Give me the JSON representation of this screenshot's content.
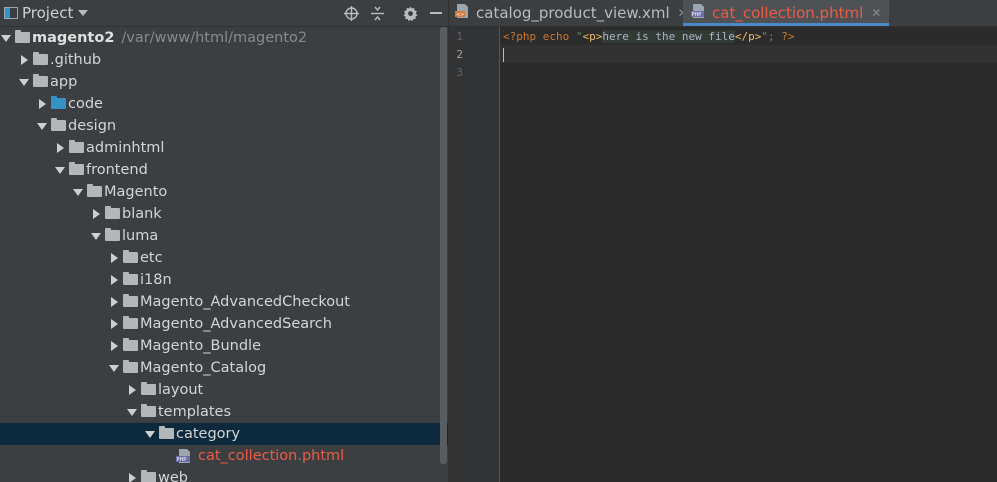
{
  "project_panel": {
    "title": "Project",
    "header_icons": [
      "locate-icon",
      "collapse-all-icon",
      "settings-gear-icon",
      "hide-panel-icon"
    ],
    "tree": [
      {
        "label": "magento2",
        "path": "/var/www/html/magento2",
        "depth": 0,
        "expanded": true,
        "icon": "folder-icon",
        "bold": true
      },
      {
        "label": ".github",
        "depth": 1,
        "expanded": false,
        "icon": "folder-icon"
      },
      {
        "label": "app",
        "depth": 1,
        "expanded": true,
        "icon": "folder-icon"
      },
      {
        "label": "code",
        "depth": 2,
        "expanded": false,
        "icon": "source-folder-icon"
      },
      {
        "label": "design",
        "depth": 2,
        "expanded": true,
        "icon": "folder-icon"
      },
      {
        "label": "adminhtml",
        "depth": 3,
        "expanded": false,
        "icon": "folder-icon"
      },
      {
        "label": "frontend",
        "depth": 3,
        "expanded": true,
        "icon": "folder-icon"
      },
      {
        "label": "Magento",
        "depth": 4,
        "expanded": true,
        "icon": "folder-icon"
      },
      {
        "label": "blank",
        "depth": 5,
        "expanded": false,
        "icon": "folder-icon"
      },
      {
        "label": "luma",
        "depth": 5,
        "expanded": true,
        "icon": "folder-icon"
      },
      {
        "label": "etc",
        "depth": 6,
        "expanded": false,
        "icon": "folder-icon"
      },
      {
        "label": "i18n",
        "depth": 6,
        "expanded": false,
        "icon": "folder-icon"
      },
      {
        "label": "Magento_AdvancedCheckout",
        "depth": 6,
        "expanded": false,
        "icon": "folder-icon"
      },
      {
        "label": "Magento_AdvancedSearch",
        "depth": 6,
        "expanded": false,
        "icon": "folder-icon"
      },
      {
        "label": "Magento_Bundle",
        "depth": 6,
        "expanded": false,
        "icon": "folder-icon"
      },
      {
        "label": "Magento_Catalog",
        "depth": 6,
        "expanded": true,
        "icon": "folder-icon"
      },
      {
        "label": "layout",
        "depth": 7,
        "expanded": false,
        "icon": "folder-icon"
      },
      {
        "label": "templates",
        "depth": 7,
        "expanded": true,
        "icon": "folder-icon"
      },
      {
        "label": "category",
        "depth": 8,
        "expanded": true,
        "icon": "folder-icon",
        "selected": true
      },
      {
        "label": "cat_collection.phtml",
        "depth": 9,
        "icon": "php-file-icon",
        "file": true,
        "modified": true
      },
      {
        "label": "web",
        "depth": 7,
        "expanded": false,
        "icon": "folder-icon"
      }
    ]
  },
  "editor": {
    "tabs": [
      {
        "label": "catalog_product_view.xml",
        "icon": "xml-file-icon",
        "active": false
      },
      {
        "label": "cat_collection.phtml",
        "icon": "php-file-icon",
        "active": true
      }
    ],
    "line_numbers": [
      "1",
      "2",
      "3"
    ],
    "current_line": 2,
    "code": {
      "open_tag": "<?php",
      "echo_kw": "echo",
      "quote_open": "\"",
      "p_open": "<p>",
      "text": "here is the new file",
      "p_close": "</p>",
      "quote_close": "\";",
      "close_tag": "?>"
    }
  },
  "colors": {
    "panel_bg": "#3c3f41",
    "editor_bg": "#2b2b2b",
    "selection": "#0d293e",
    "modified_file": "#e85c48",
    "keyword": "#cc7832",
    "string": "#6a8759",
    "html_tag": "#e8bf6a"
  }
}
